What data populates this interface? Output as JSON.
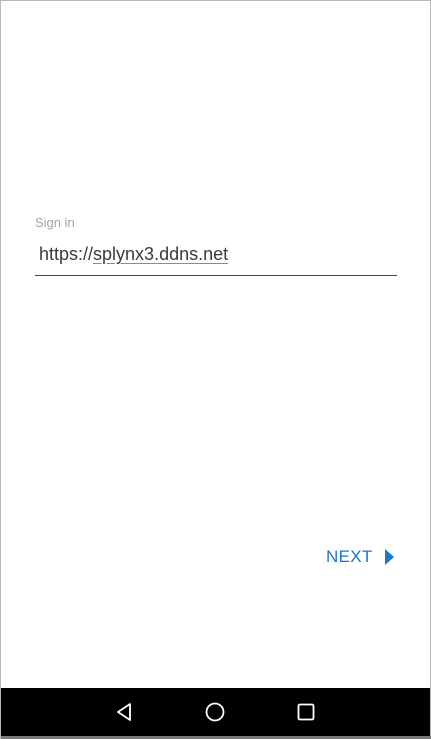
{
  "sign_in": {
    "label": "Sign in",
    "url_scheme": "https://",
    "url_host": "splynx3.ddns.net"
  },
  "actions": {
    "next_label": "NEXT"
  },
  "nav": {
    "icons": [
      "back-icon",
      "home-icon",
      "recent-apps-icon"
    ]
  },
  "colors": {
    "accent": "#1976d2",
    "navbar": "#000000",
    "label": "#a4a4a4"
  }
}
